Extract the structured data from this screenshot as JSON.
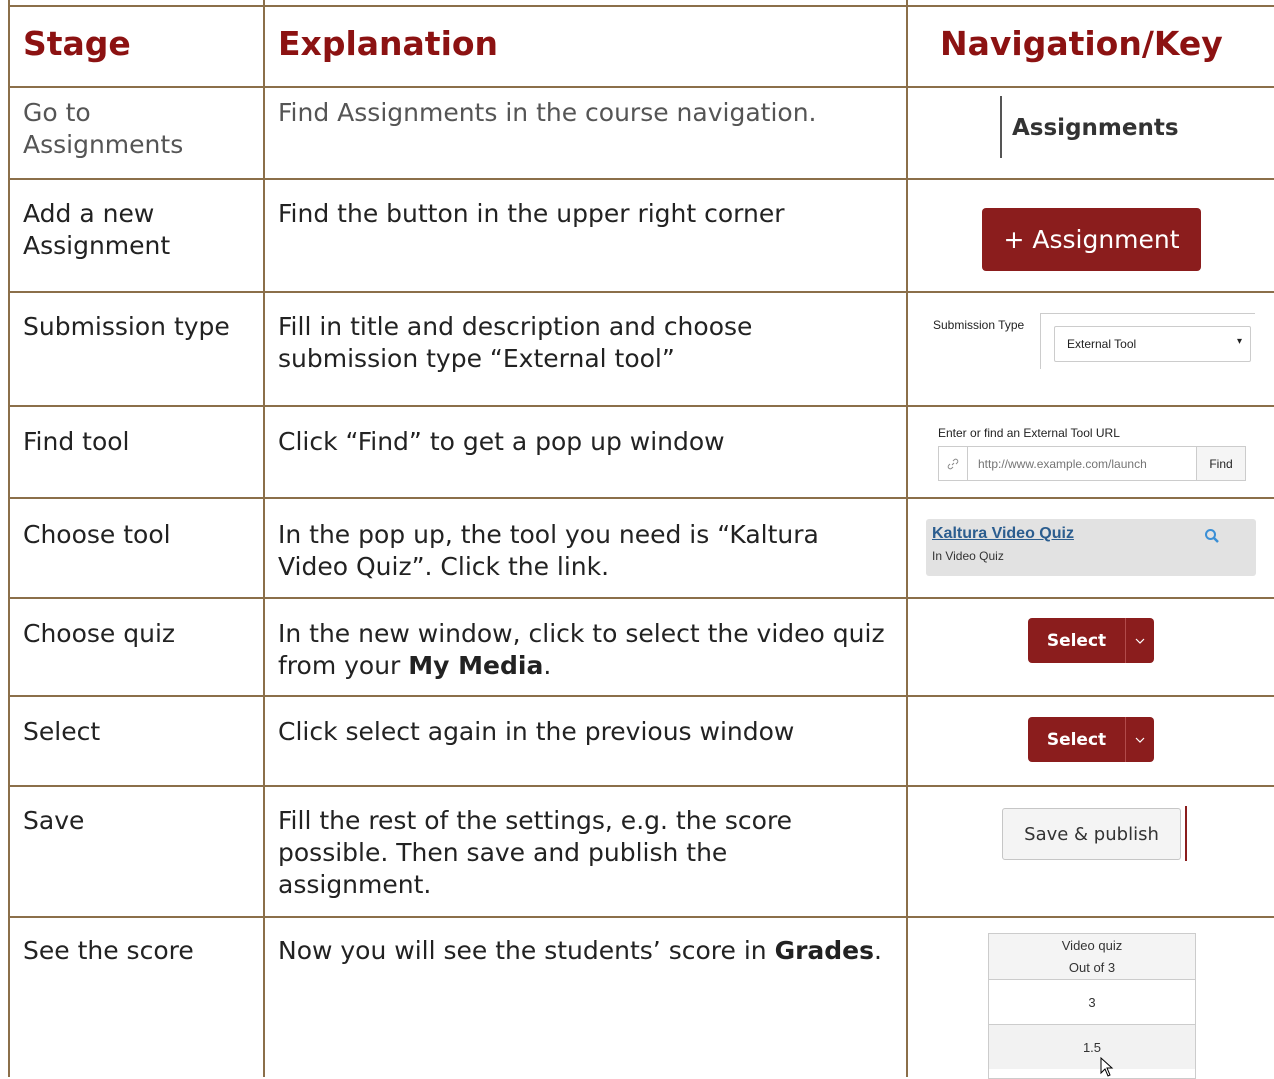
{
  "headers": {
    "stage": "Stage",
    "explanation": "Explanation",
    "navigation": "Navigation/Key"
  },
  "rows": [
    {
      "stage": "Go to Assignments",
      "explanation": "Find Assignments in the course navigation."
    },
    {
      "stage": "Add a new Assignment",
      "explanation": "Find the button in the upper right corner"
    },
    {
      "stage": "Submission type",
      "explanation": "Fill in title and description and choose submission type “External tool”"
    },
    {
      "stage": "Find tool",
      "explanation": "Click “Find” to get a pop up window"
    },
    {
      "stage": "Choose tool",
      "explanation": "In the pop up, the tool you need is “Kaltura Video Quiz”. Click the link."
    },
    {
      "stage": "Choose quiz",
      "explanation_prefix": "In the new window, click to select the video quiz from your ",
      "explanation_bold": "My Media",
      "explanation_suffix": "."
    },
    {
      "stage": "Select",
      "explanation": "Click select again in the previous window"
    },
    {
      "stage": "Save",
      "explanation": "Fill the rest of the settings, e.g. the score possible. Then save and publish the assignment."
    },
    {
      "stage": "See the score",
      "explanation_prefix": "Now you will see the students’ score in ",
      "explanation_bold": "Grades",
      "explanation_suffix": "."
    }
  ],
  "nav": {
    "assignments_link": "Assignments",
    "add_assignment_button": "+ Assignment",
    "submission_type_label": "Submission Type",
    "submission_type_value": "External Tool",
    "submission_type_caret": "▾",
    "tool_url_label": "Enter or find an External Tool URL",
    "tool_url_placeholder": "http://www.example.com/launch",
    "find_button": "Find",
    "kaltura_title": "Kaltura Video Quiz",
    "kaltura_subtitle": "In Video Quiz",
    "select_label": "Select",
    "select_label_2": "Select",
    "save_publish": "Save & publish",
    "grades_header_1": "Video quiz",
    "grades_header_2": "Out of 3",
    "grades_values": [
      "3",
      "1.5"
    ]
  },
  "colors": {
    "header": "#8c1212",
    "button": "#8b1d1d",
    "border": "#8b6f4a"
  }
}
